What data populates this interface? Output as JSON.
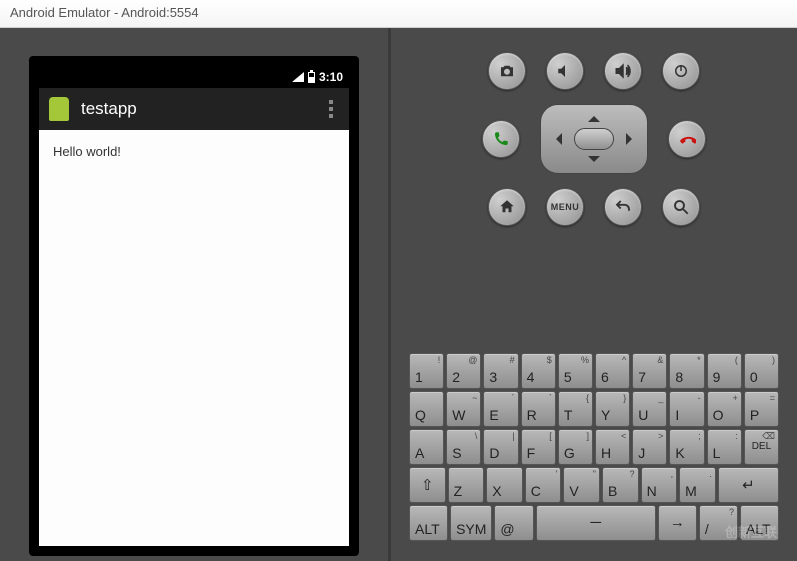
{
  "window": {
    "title": "Android Emulator - Android:5554"
  },
  "device": {
    "status": {
      "time": "3:10"
    },
    "app_title": "testapp",
    "content_text": "Hello world!"
  },
  "controls": {
    "row1": [
      "camera",
      "vol-down",
      "vol-up",
      "power"
    ],
    "row2": [
      "call",
      "dpad",
      "hangup"
    ],
    "row3": [
      "home",
      "menu",
      "back",
      "search"
    ],
    "menu_label": "MENU"
  },
  "keyboard": {
    "rows": [
      [
        {
          "m": "1",
          "a": "!"
        },
        {
          "m": "2",
          "a": "@"
        },
        {
          "m": "3",
          "a": "#"
        },
        {
          "m": "4",
          "a": "$"
        },
        {
          "m": "5",
          "a": "%"
        },
        {
          "m": "6",
          "a": "^"
        },
        {
          "m": "7",
          "a": "&"
        },
        {
          "m": "8",
          "a": "*"
        },
        {
          "m": "9",
          "a": "("
        },
        {
          "m": "0",
          "a": ")"
        }
      ],
      [
        {
          "m": "Q"
        },
        {
          "m": "W",
          "a": "~"
        },
        {
          "m": "E",
          "a": "´"
        },
        {
          "m": "R",
          "a": "`"
        },
        {
          "m": "T",
          "a": "{"
        },
        {
          "m": "Y",
          "a": "}"
        },
        {
          "m": "U",
          "a": "_"
        },
        {
          "m": "I",
          "a": "-"
        },
        {
          "m": "O",
          "a": "+"
        },
        {
          "m": "P",
          "a": "="
        }
      ],
      [
        {
          "m": "A"
        },
        {
          "m": "S",
          "a": "\\"
        },
        {
          "m": "D",
          "a": "|"
        },
        {
          "m": "F",
          "a": "["
        },
        {
          "m": "G",
          "a": "]"
        },
        {
          "m": "H",
          "a": "<"
        },
        {
          "m": "J",
          "a": ">"
        },
        {
          "m": "K",
          "a": ";"
        },
        {
          "m": "L",
          "a": ":"
        },
        {
          "m": "DEL",
          "a": "",
          "icon": "del"
        }
      ],
      [
        {
          "m": "⇧",
          "icon": "shift"
        },
        {
          "m": "Z"
        },
        {
          "m": "X"
        },
        {
          "m": "C",
          "a": "'"
        },
        {
          "m": "V",
          "a": "\""
        },
        {
          "m": "B",
          "a": "?"
        },
        {
          "m": "N",
          "a": ","
        },
        {
          "m": "M",
          "a": "."
        },
        {
          "m": "↵",
          "icon": "enter",
          "w": "k2"
        }
      ],
      [
        {
          "m": "ALT",
          "w": "k1"
        },
        {
          "m": "SYM",
          "w": "k1"
        },
        {
          "m": "@",
          "w": "k1"
        },
        {
          "m": "",
          "icon": "space",
          "w": "kspace"
        },
        {
          "m": "→",
          "icon": "right",
          "w": "k1"
        },
        {
          "m": "/",
          "a": "?",
          "w": "k1"
        },
        {
          "m": "ALT",
          "w": "k1"
        }
      ]
    ]
  },
  "watermark": "创新互联"
}
